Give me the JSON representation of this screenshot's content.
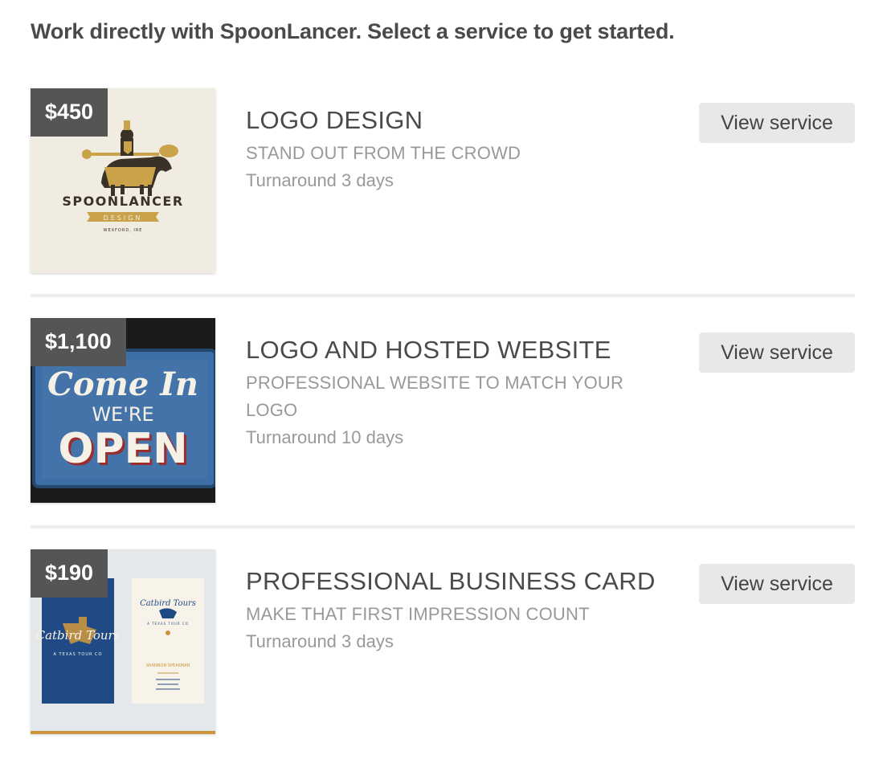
{
  "heading": "Work directly with SpoonLancer. Select a service to get started.",
  "services": [
    {
      "price": "$450",
      "title": "LOGO DESIGN",
      "tagline": "STAND OUT FROM THE CROWD",
      "turnaround": "Turnaround 3 days",
      "button": "View service",
      "image": {
        "brand": "SPOONLANCER",
        "ribbon": "DESIGN",
        "location": "WEXFORD, IRE",
        "bg": "#f0ece2",
        "gold": "#c9a24a",
        "dark": "#3a3226"
      }
    },
    {
      "price": "$1,100",
      "title": "LOGO AND HOSTED WEBSITE",
      "tagline": "PROFESSIONAL WEBSITE TO MATCH YOUR LOGO",
      "turnaround": "Turnaround 10 days",
      "button": "View service",
      "image": {
        "line1": "Come In",
        "line2": "WE'RE",
        "line3": "OPEN",
        "sign_color": "#3d6ea5",
        "bg": "#111111"
      }
    },
    {
      "price": "$190",
      "title": "PROFESSIONAL BUSINESS CARD",
      "tagline": "MAKE THAT FIRST IMPRESSION COUNT",
      "turnaround": "Turnaround 3 days",
      "button": "View service",
      "image": {
        "brand": "Catbird Tours",
        "subtitle": "A TEXAS TOUR CO",
        "person": "SHANNON SPEAKMAN",
        "card_blue": "#1f4a86",
        "card_cream": "#f8f3e8",
        "accent": "#c9953f"
      }
    }
  ]
}
